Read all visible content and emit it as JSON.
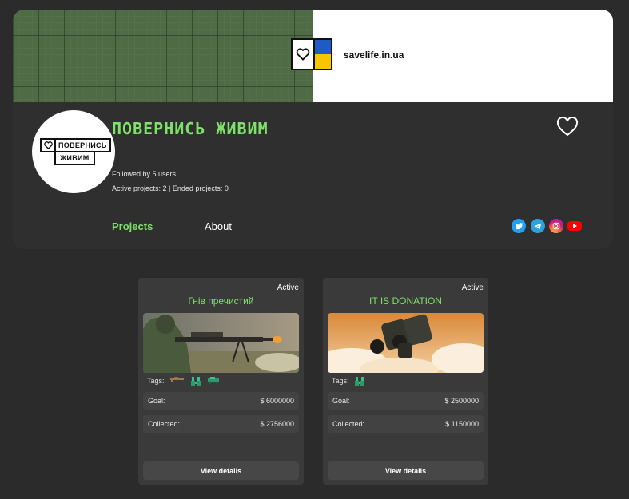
{
  "banner": {
    "url_text": "savelife.in.ua"
  },
  "organization": {
    "title": "ПОВЕРНИСЬ ЖИВИМ",
    "logo_line1": "ПОВЕРНИСЬ",
    "logo_line2": "ЖИВИМ",
    "followed": "Followed by 5 users",
    "projects_count": "Active projects: 2 | Ended projects: 0",
    "favorite_icon": "heart-outline-icon"
  },
  "tabs": [
    {
      "label": "Projects",
      "active": true
    },
    {
      "label": "About",
      "active": false
    }
  ],
  "social": [
    "twitter-icon",
    "telegram-icon",
    "instagram-icon",
    "youtube-icon"
  ],
  "colors": {
    "accent": "#7fe06a",
    "background": "#2b2b2b",
    "card": "#3a3a3a"
  },
  "projects": [
    {
      "status": "Active",
      "title": "Гнів пречистий",
      "image": "sniper-photo",
      "tags_label": "Tags:",
      "tags": [
        "rifle-icon",
        "binoculars-icon",
        "vehicle-icon"
      ],
      "goal_label": "Goal:",
      "goal_value": "$ 6000000",
      "collected_label": "Collected:",
      "collected_value": "$ 2756000",
      "button": "View details"
    },
    {
      "status": "Active",
      "title": "IT IS DONATION",
      "image": "binoculars-photo",
      "tags_label": "Tags:",
      "tags": [
        "binoculars-icon"
      ],
      "goal_label": "Goal:",
      "goal_value": "$ 2500000",
      "collected_label": "Collected:",
      "collected_value": "$ 1150000",
      "button": "View details"
    }
  ]
}
